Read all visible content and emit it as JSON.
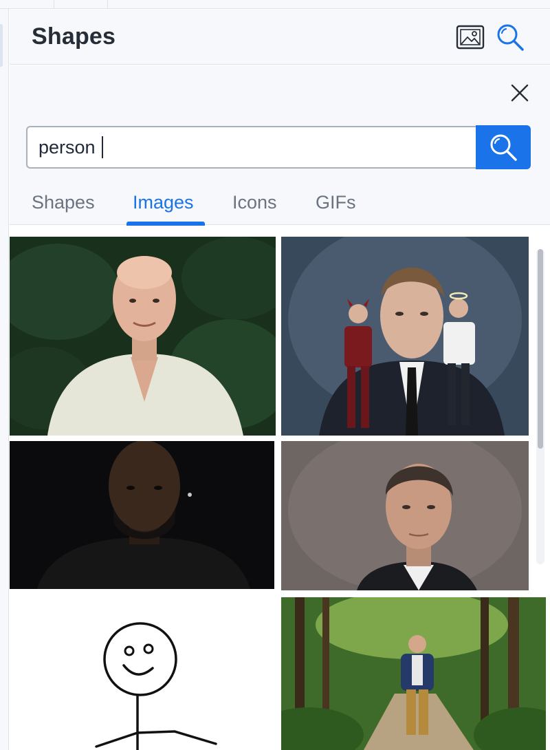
{
  "panel": {
    "title": "Shapes",
    "header_icons": [
      "image-icon",
      "search-icon"
    ]
  },
  "search": {
    "value": "person",
    "close_icon": "close-icon",
    "submit_icon": "search-icon"
  },
  "tabs": [
    {
      "label": "Shapes",
      "active": false
    },
    {
      "label": "Images",
      "active": true
    },
    {
      "label": "Icons",
      "active": false
    },
    {
      "label": "GIFs",
      "active": false
    }
  ],
  "results": [
    {
      "subject": "bald man in light shirt, green foliage background"
    },
    {
      "subject": "man in suit with small devil and angel figures on shoulders"
    },
    {
      "subject": "man in black t-shirt on dark background"
    },
    {
      "subject": "man in dark suit and white shirt, grey background"
    },
    {
      "subject": "hand-drawn stick figure"
    },
    {
      "subject": "man in blue blazer walking on forest path"
    }
  ],
  "colors": {
    "accent": "#1a73e8",
    "panel_bg": "#f6f8fb",
    "border": "#dfe3e8",
    "title_text": "#262d36",
    "inactive_tab": "#6b7280"
  }
}
